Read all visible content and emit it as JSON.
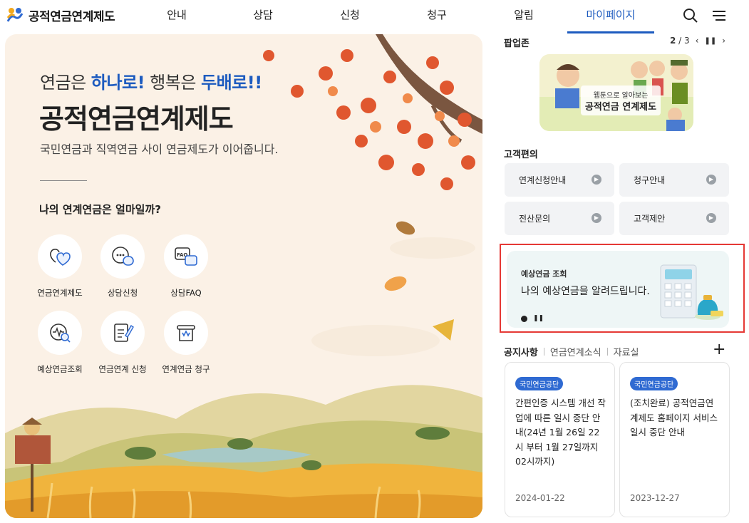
{
  "logo": {
    "text": "공적연금연계제도"
  },
  "nav": {
    "items": [
      {
        "label": "안내"
      },
      {
        "label": "상담"
      },
      {
        "label": "신청"
      },
      {
        "label": "청구"
      },
      {
        "label": "알림"
      },
      {
        "label": "마이페이지",
        "active": true
      }
    ],
    "icons": [
      "search-icon",
      "menu-icon"
    ]
  },
  "hero": {
    "tagline_prefix": "연금은 ",
    "tagline_hl1": "하나로!",
    "tagline_mid": " 행복은 ",
    "tagline_hl2": "두배로!!",
    "title": "공적연금연계제도",
    "desc": "국민연금과 직역연금 사이 연금제도가 이어줍니다.",
    "question": "나의 연계연금은 얼마일까?",
    "quick": [
      {
        "label": "연금연계제도",
        "icon": "heart-icon"
      },
      {
        "label": "상담신청",
        "icon": "chat-icon"
      },
      {
        "label": "상담FAQ",
        "icon": "faq-icon"
      },
      {
        "label": "예상연금조회",
        "icon": "pension-search-icon"
      },
      {
        "label": "연금연계 신청",
        "icon": "form-pen-icon"
      },
      {
        "label": "연계연금 청구",
        "icon": "claim-icon"
      }
    ]
  },
  "popup": {
    "title": "팝업존",
    "current": "2",
    "total": "3",
    "image_line1": "웹툰으로 알아보는",
    "image_line2": "공적연금 연계제도"
  },
  "service": {
    "title": "고객편의",
    "items": [
      {
        "label": "연계신청안내"
      },
      {
        "label": "청구안내"
      },
      {
        "label": "전산문의"
      },
      {
        "label": "고객제안"
      }
    ]
  },
  "estimate": {
    "label": "예상연금 조회",
    "text": "나의 예상연금을 알려드립니다."
  },
  "notices": {
    "tabs": [
      {
        "label": "공지사항",
        "active": true
      },
      {
        "label": "연금연계소식"
      },
      {
        "label": "자료실"
      }
    ],
    "items": [
      {
        "badge": "국민연금공단",
        "title": "간편인증 시스템 개선 작업에 따른 일시 중단 안내(24년 1월 26일 22시 부터 1월 27일까지 02시까지)",
        "date": "2024-01-22"
      },
      {
        "badge": "국민연금공단",
        "title": "(조치완료) 공적연금연계제도 홈페이지 서비스 일시 중단 안내",
        "date": "2023-12-27"
      }
    ]
  },
  "colors": {
    "accent": "#1d5bbf",
    "highlight_border": "#e53935",
    "badge": "#2f6ad2"
  }
}
